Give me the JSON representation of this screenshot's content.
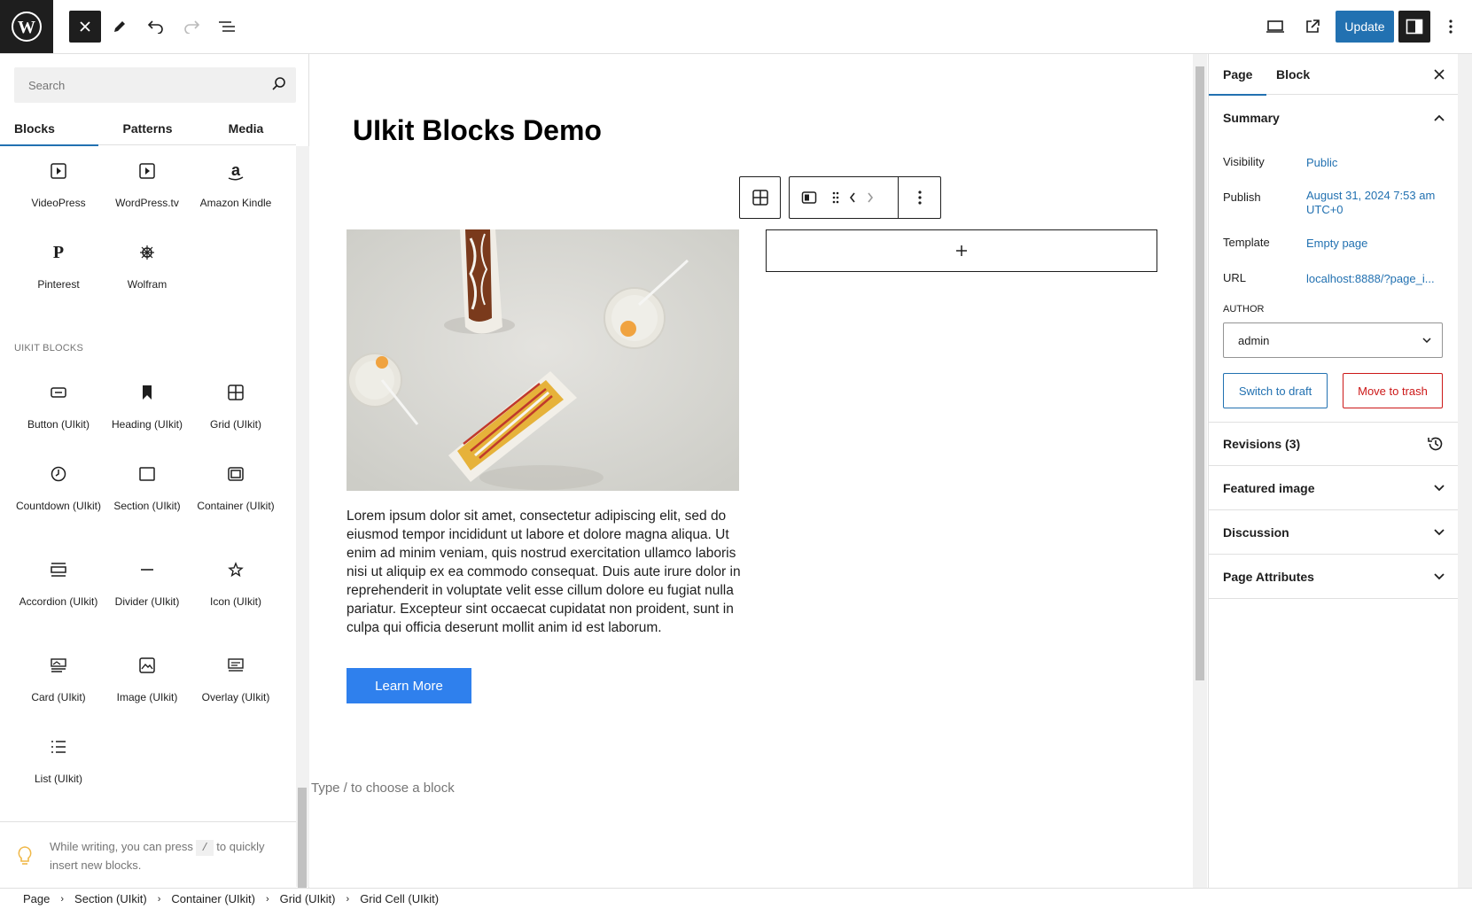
{
  "toolbar": {
    "update_label": "Update",
    "icons": [
      "wordpress-logo",
      "close-icon",
      "pencil-icon",
      "undo-icon",
      "redo-icon",
      "list-view-icon",
      "desktop-preview-icon",
      "external-link-icon",
      "sidebar-toggle-icon",
      "options-icon"
    ]
  },
  "inserter": {
    "search_placeholder": "Search",
    "tabs": [
      "Blocks",
      "Patterns",
      "Media"
    ],
    "embeds": [
      {
        "label": "VideoPress",
        "icon": "video-icon"
      },
      {
        "label": "WordPress.tv",
        "icon": "video-icon"
      },
      {
        "label": "Amazon Kindle",
        "icon": "amazon-icon"
      },
      {
        "label": "Pinterest",
        "icon": "pinterest-icon"
      },
      {
        "label": "Wolfram",
        "icon": "wolfram-icon"
      }
    ],
    "category_title": "UIKIT BLOCKS",
    "uikit_blocks": [
      {
        "label": "Button (UIkit)",
        "icon": "button-icon"
      },
      {
        "label": "Heading (UIkit)",
        "icon": "bookmark-icon"
      },
      {
        "label": "Grid (UIkit)",
        "icon": "grid-icon"
      },
      {
        "label": "Countdown (UIkit)",
        "icon": "clock-icon"
      },
      {
        "label": "Section (UIkit)",
        "icon": "section-icon"
      },
      {
        "label": "Container (UIkit)",
        "icon": "container-icon"
      },
      {
        "label": "Accordion (UIkit)",
        "icon": "accordion-icon"
      },
      {
        "label": "Divider (UIkit)",
        "icon": "divider-icon"
      },
      {
        "label": "Icon (UIkit)",
        "icon": "star-icon"
      },
      {
        "label": "Card (UIkit)",
        "icon": "card-icon"
      },
      {
        "label": "Image (UIkit)",
        "icon": "image-icon"
      },
      {
        "label": "Overlay (UIkit)",
        "icon": "overlay-icon"
      },
      {
        "label": "List (UIkit)",
        "icon": "list-icon"
      }
    ],
    "tip_before": "While writing, you can press",
    "tip_key": "/",
    "tip_after": "to quickly insert new blocks."
  },
  "canvas": {
    "title": "UIkit Blocks Demo",
    "paragraph": "Lorem ipsum dolor sit amet, consectetur adipiscing elit, sed do eiusmod tempor incididunt ut labore et dolore magna aliqua. Ut enim ad minim veniam, quis nostrud exercitation ullamco laboris nisi ut aliquip ex ea commodo consequat. Duis aute irure dolor in reprehenderit in voluptate velit esse cillum dolore eu fugiat nulla pariatur. Excepteur sint occaecat cupidatat non proident, sunt in culpa qui officia deserunt mollit anim id est laborum.",
    "button_label": "Learn More",
    "add_label": "+",
    "placeholder": "Type / to choose a block"
  },
  "sidebar": {
    "tab_page": "Page",
    "tab_block": "Block",
    "summary": "Summary",
    "visibility_label": "Visibility",
    "visibility_value": "Public",
    "publish_label": "Publish",
    "publish_value_1": "August 31, 2024 7:53 am",
    "publish_value_2": "UTC+0",
    "template_label": "Template",
    "template_value": "Empty page",
    "url_label": "URL",
    "url_value": "localhost:8888/?page_i...",
    "author_label": "AUTHOR",
    "author_value": "admin",
    "switch_draft": "Switch to draft",
    "move_trash": "Move to trash",
    "revisions": "Revisions (3)",
    "featured_image": "Featured image",
    "discussion": "Discussion",
    "page_attributes": "Page Attributes"
  },
  "breadcrumb": [
    "Page",
    "Section (UIkit)",
    "Container (UIkit)",
    "Grid (UIkit)",
    "Grid Cell (UIkit)"
  ],
  "colors": {
    "accent": "#2271b1",
    "danger": "#cc1818",
    "learn_button": "#2f80ed",
    "dark": "#1e1e1e"
  }
}
